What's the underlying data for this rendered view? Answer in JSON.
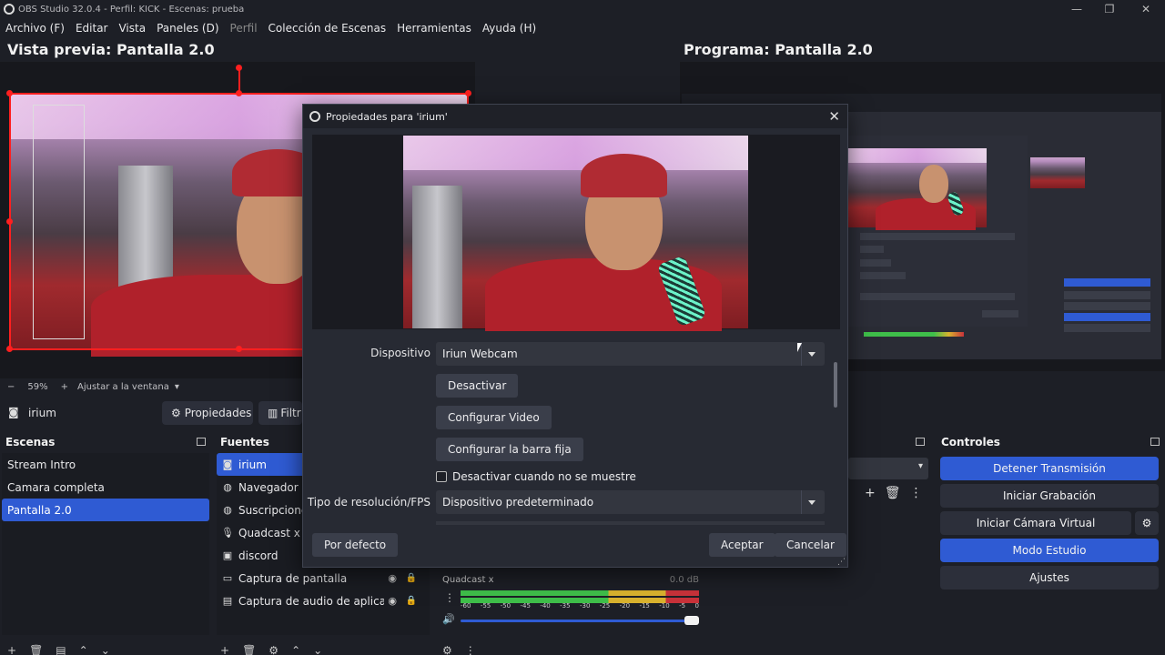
{
  "window": {
    "title": "OBS Studio 32.0.4 - Perfil: KICK - Escenas: prueba"
  },
  "menu": [
    {
      "label": "Archivo (F)",
      "enabled": true
    },
    {
      "label": "Editar",
      "enabled": true
    },
    {
      "label": "Vista",
      "enabled": true
    },
    {
      "label": "Paneles (D)",
      "enabled": true
    },
    {
      "label": "Perfil",
      "enabled": false
    },
    {
      "label": "Colección de Escenas",
      "enabled": true
    },
    {
      "label": "Herramientas",
      "enabled": true
    },
    {
      "label": "Ayuda (H)",
      "enabled": true
    }
  ],
  "preview": {
    "title": "Vista previa: Pantalla 2.0",
    "zoom": "59%",
    "fit_label": "Ajustar a la ventana",
    "minus": "−",
    "plus": "+"
  },
  "program": {
    "title": "Programa: Pantalla 2.0"
  },
  "source_toolbar": {
    "selected_source": "irium",
    "properties_label": "Propiedades",
    "filters_label": "Filtr"
  },
  "scenes": {
    "title": "Escenas",
    "items": [
      "Stream Intro",
      "Camara completa",
      "Pantalla 2.0"
    ],
    "active_index": 2
  },
  "sources": {
    "title": "Fuentes",
    "items": [
      {
        "label": "irium",
        "icon": "camera-icon"
      },
      {
        "label": "Navegador",
        "icon": "globe-icon"
      },
      {
        "label": "Suscripciones",
        "icon": "globe-icon"
      },
      {
        "label": "Quadcast x",
        "icon": "mic-icon"
      },
      {
        "label": "discord",
        "icon": "window-icon"
      },
      {
        "label": "Captura de pantalla",
        "icon": "monitor-icon"
      },
      {
        "label": "Captura de audio de aplicación (",
        "icon": "app-audio-icon"
      }
    ],
    "active_index": 0
  },
  "controls": {
    "title": "Controles",
    "buttons": {
      "stop_stream": "Detener Transmisión",
      "start_recording": "Iniciar Grabación",
      "start_virtual_cam": "Iniciar Cámara Virtual",
      "studio_mode": "Modo Estudio",
      "settings": "Ajustes"
    }
  },
  "mixer": {
    "channel": "Quadcast x",
    "db": "0.0 dB",
    "scale": [
      "-60",
      "-55",
      "-50",
      "-45",
      "-40",
      "-35",
      "-30",
      "-25",
      "-20",
      "-15",
      "-10",
      "-5",
      "0"
    ],
    "volume_level": 1.0
  },
  "dialog": {
    "title": "Propiedades para 'irium'",
    "device_label": "Dispositivo",
    "device_value": "Iriun Webcam",
    "deactivate": "Desactivar",
    "configure_video": "Configurar Video",
    "configure_crossbar": "Configurar la barra fija",
    "hide_checkbox_label": "Desactivar cuando no se muestre",
    "hide_checkbox_checked": false,
    "resolution_label": "Tipo de resolución/FPS",
    "resolution_value": "Dispositivo predeterminado",
    "defaults_button": "Por defecto",
    "accept_button": "Aceptar",
    "cancel_button": "Cancelar"
  },
  "colors": {
    "accent": "#2f5bd3",
    "background": "#1d1f26",
    "selection_outline": "#ff1f1f",
    "meter_green": "#3fbf4a",
    "meter_yellow": "#d9b22e",
    "meter_red": "#c8323a"
  }
}
